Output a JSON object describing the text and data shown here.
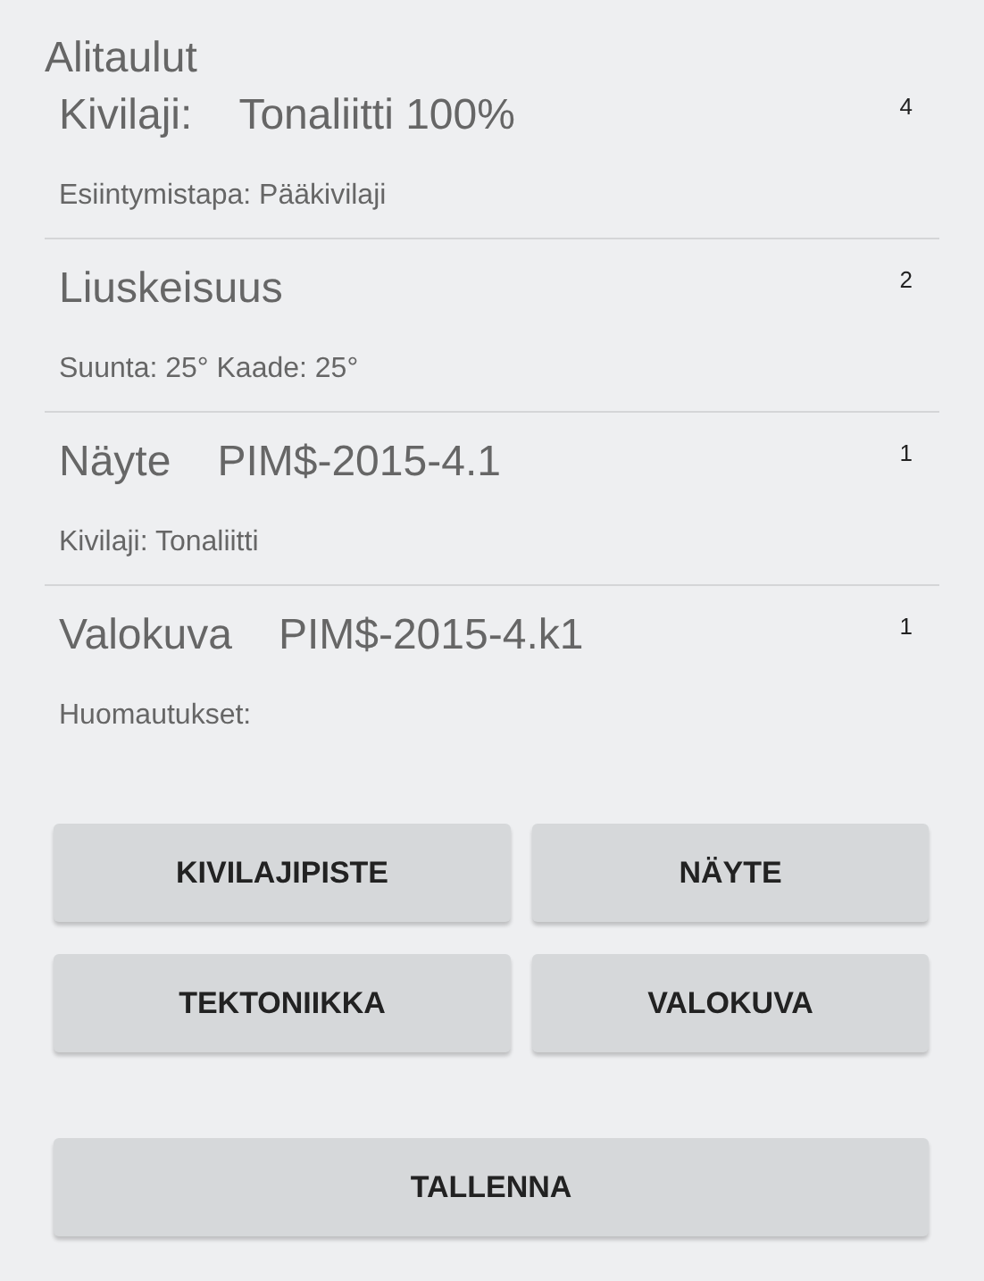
{
  "title": "Alitaulut",
  "items": [
    {
      "label": "Kivilaji:",
      "value": "Tonaliitti 100%",
      "count": "4",
      "detail": "Esiintymistapa: Pääkivilaji"
    },
    {
      "label": "Liuskeisuus",
      "count": "2",
      "detail": "Suunta: 25° Kaade: 25°"
    },
    {
      "label": "Näyte",
      "value": "PIM$-2015-4.1",
      "count": "1",
      "detail": "Kivilaji: Tonaliitti"
    },
    {
      "label": "Valokuva",
      "value": "PIM$-2015-4.k1",
      "count": "1",
      "detail": "Huomautukset:"
    }
  ],
  "add_buttons": [
    "KIVILAJIPISTE",
    "NÄYTE",
    "TEKTONIIKKA",
    "VALOKUVA"
  ],
  "save_button": "TALLENNA"
}
